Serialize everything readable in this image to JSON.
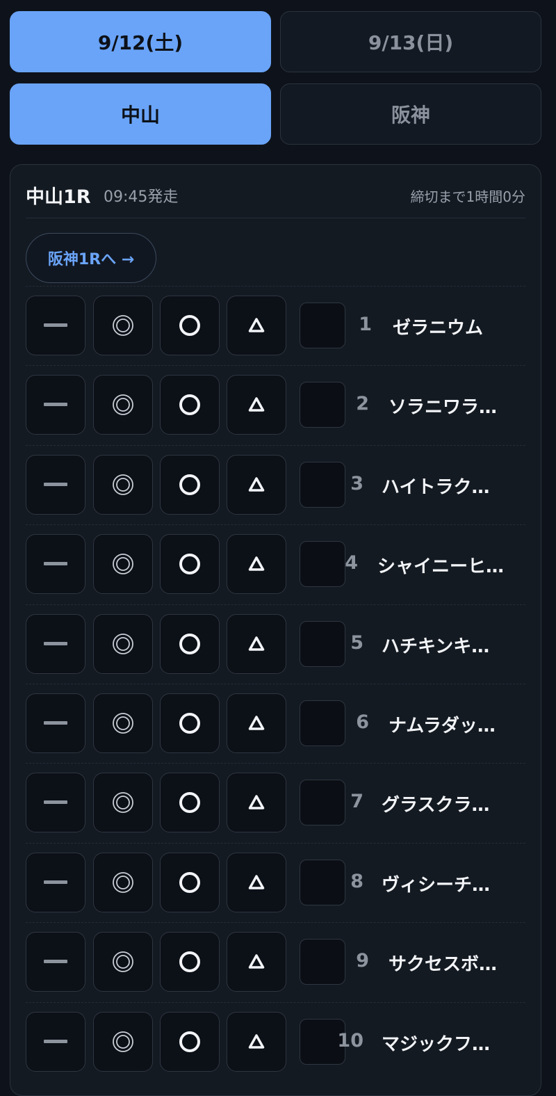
{
  "dates": [
    {
      "label": "9/12(土)",
      "active": true
    },
    {
      "label": "9/13(日)",
      "active": false
    }
  ],
  "venues": [
    {
      "label": "中山",
      "active": true
    },
    {
      "label": "阪神",
      "active": false
    }
  ],
  "race": {
    "title": "中山1R",
    "start_time": "09:45発走",
    "deadline": "締切まで1時間0分",
    "next_button": "阪神1Rへ →"
  },
  "mark_icons": [
    "dash-icon",
    "double-circle-icon",
    "circle-icon",
    "triangle-icon"
  ],
  "horses": [
    {
      "number": "1",
      "name": "ゼラニウム"
    },
    {
      "number": "2",
      "name": "ソラニワラ…"
    },
    {
      "number": "3",
      "name": "ハイトラク…"
    },
    {
      "number": "4",
      "name": "シャイニーヒ…"
    },
    {
      "number": "5",
      "name": "ハチキンキ…"
    },
    {
      "number": "6",
      "name": "ナムラダッ…"
    },
    {
      "number": "7",
      "name": "グラスクラ…"
    },
    {
      "number": "8",
      "name": "ヴィシーチ…"
    },
    {
      "number": "9",
      "name": "サクセスボ…"
    },
    {
      "number": "10",
      "name": "マジックフ…"
    }
  ],
  "colors": {
    "accent": "#6aa4f8",
    "background": "#0e131b",
    "card": "#141a22"
  }
}
